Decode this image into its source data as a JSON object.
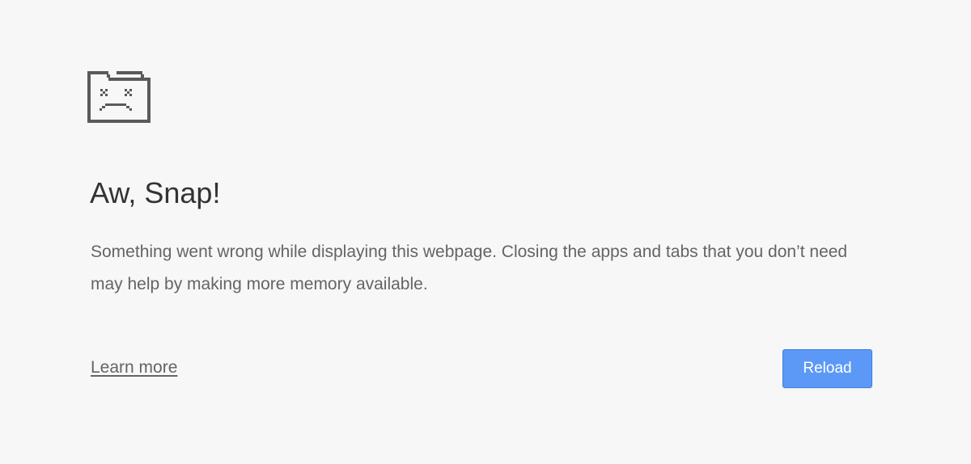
{
  "error": {
    "icon": "sad-tab-icon",
    "title": "Aw, Snap!",
    "message": "Something went wrong while displaying this webpage. Closing the apps and tabs that you don’t need may help by making more memory available.",
    "learn_more_label": "Learn more",
    "reload_label": "Reload"
  },
  "colors": {
    "background": "#f7f7f7",
    "title": "#333333",
    "body_text": "#646464",
    "icon": "#5a5a5a",
    "button_fill": "#5c99f7",
    "button_border": "#3d7ce2"
  }
}
